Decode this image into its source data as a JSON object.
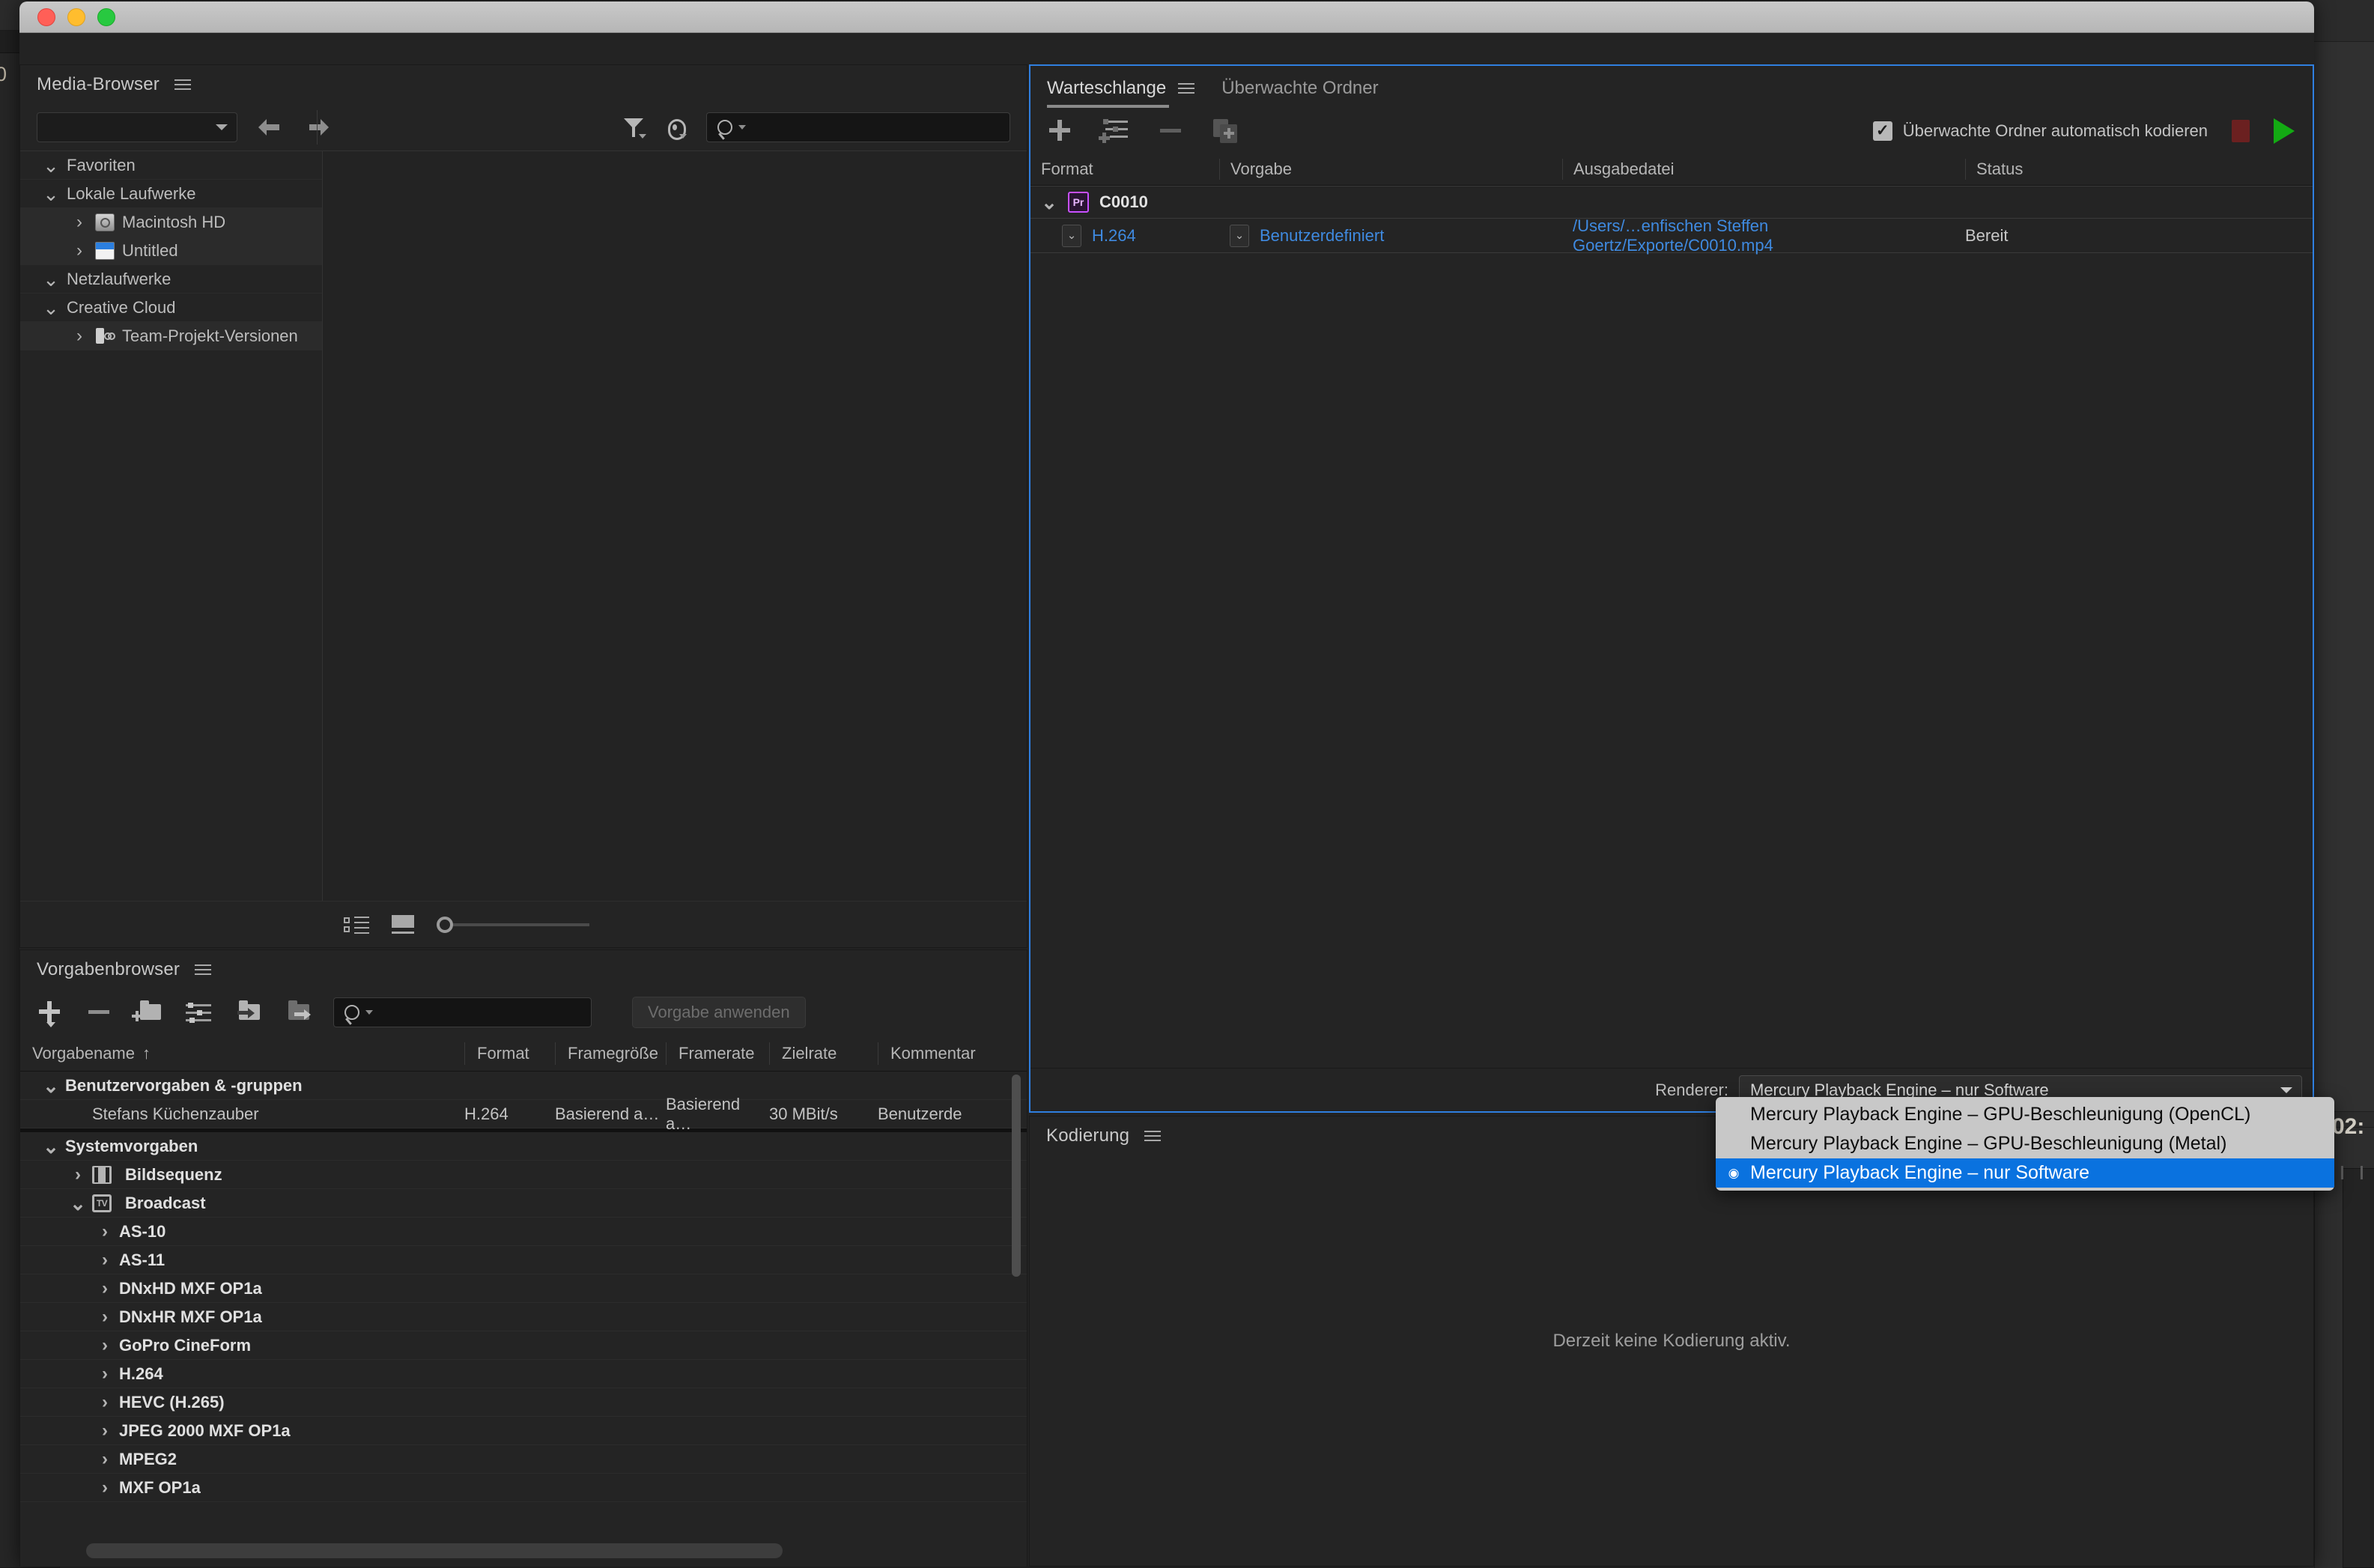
{
  "app": {
    "titlebar_buttons": [
      "close",
      "minimize",
      "maximize"
    ]
  },
  "background": {
    "left_fragment_text": "0",
    "right_fragment_text": "02:"
  },
  "media_browser": {
    "title": "Media-Browser",
    "path_value": "",
    "search_placeholder": "",
    "icons": {
      "menu": "hamburger-icon",
      "back": "back-arrow-icon",
      "forward": "forward-arrow-icon",
      "filter": "funnel-icon",
      "visibility": "eye-icon",
      "search": "search-icon",
      "list_view": "list-view-icon",
      "thumbnail_view": "thumbnail-view-icon",
      "zoom": "zoom-slider-icon"
    },
    "tree": [
      {
        "label": "Favoriten",
        "twisty": "down",
        "indent": 0,
        "icon": null,
        "highlight": false
      },
      {
        "label": "Lokale Laufwerke",
        "twisty": "down",
        "indent": 0,
        "icon": null,
        "highlight": false
      },
      {
        "label": "Macintosh HD",
        "twisty": "right",
        "indent": 1,
        "icon": "harddisk-icon",
        "highlight": true
      },
      {
        "label": "Untitled",
        "twisty": "right",
        "indent": 1,
        "icon": "volume-icon",
        "highlight": true
      },
      {
        "label": "Netzlaufwerke",
        "twisty": "down",
        "indent": 0,
        "icon": null,
        "highlight": false
      },
      {
        "label": "Creative Cloud",
        "twisty": "down",
        "indent": 0,
        "icon": null,
        "highlight": false
      },
      {
        "label": "Team-Projekt-Versionen",
        "twisty": "right",
        "indent": 1,
        "icon": "team-project-icon",
        "highlight": true
      }
    ]
  },
  "preset_browser": {
    "title": "Vorgabenbrowser",
    "search_placeholder": "",
    "apply_button": "Vorgabe anwenden",
    "icons": {
      "menu": "hamburger-icon",
      "new_preset": "new-preset-plus-icon",
      "delete_preset": "delete-preset-minus-icon",
      "new_group": "new-folder-icon",
      "settings": "preset-settings-icon",
      "import_preset": "import-preset-icon",
      "export_preset": "export-preset-icon",
      "search": "search-icon"
    },
    "columns": [
      "Vorgabename",
      "Format",
      "Framegröße",
      "Framerate",
      "Zielrate",
      "Kommentar"
    ],
    "sort_column": "Vorgabename",
    "sort_direction": "↑",
    "rows": [
      {
        "type": "group",
        "label": "Benutzervorgaben & -gruppen",
        "twisty": "down",
        "indent": 0,
        "icon": null,
        "format": "",
        "framesize": "",
        "framerate": "",
        "bitrate": "",
        "comment": ""
      },
      {
        "type": "preset",
        "label": "Stefans Küchenzauber",
        "twisty": "none",
        "indent": 1,
        "icon": null,
        "format": "H.264",
        "framesize": "Basierend a…",
        "framerate": "Basierend a…",
        "bitrate": "30 MBit/s",
        "comment": "Benutzerde"
      },
      {
        "type": "separator"
      },
      {
        "type": "group",
        "label": "Systemvorgaben",
        "twisty": "down",
        "indent": 0,
        "icon": null,
        "format": "",
        "framesize": "",
        "framerate": "",
        "bitrate": "",
        "comment": ""
      },
      {
        "type": "group",
        "label": "Bildsequenz",
        "twisty": "right",
        "indent": 1,
        "icon": "film-icon",
        "format": "",
        "framesize": "",
        "framerate": "",
        "bitrate": "",
        "comment": ""
      },
      {
        "type": "group",
        "label": "Broadcast",
        "twisty": "down",
        "indent": 1,
        "icon": "tv-icon",
        "format": "",
        "framesize": "",
        "framerate": "",
        "bitrate": "",
        "comment": ""
      },
      {
        "type": "group",
        "label": "AS-10",
        "twisty": "right",
        "indent": 2,
        "icon": null,
        "format": "",
        "framesize": "",
        "framerate": "",
        "bitrate": "",
        "comment": ""
      },
      {
        "type": "group",
        "label": "AS-11",
        "twisty": "right",
        "indent": 2,
        "icon": null,
        "format": "",
        "framesize": "",
        "framerate": "",
        "bitrate": "",
        "comment": ""
      },
      {
        "type": "group",
        "label": "DNxHD MXF OP1a",
        "twisty": "right",
        "indent": 2,
        "icon": null,
        "format": "",
        "framesize": "",
        "framerate": "",
        "bitrate": "",
        "comment": ""
      },
      {
        "type": "group",
        "label": "DNxHR MXF OP1a",
        "twisty": "right",
        "indent": 2,
        "icon": null,
        "format": "",
        "framesize": "",
        "framerate": "",
        "bitrate": "",
        "comment": ""
      },
      {
        "type": "group",
        "label": "GoPro CineForm",
        "twisty": "right",
        "indent": 2,
        "icon": null,
        "format": "",
        "framesize": "",
        "framerate": "",
        "bitrate": "",
        "comment": ""
      },
      {
        "type": "group",
        "label": "H.264",
        "twisty": "right",
        "indent": 2,
        "icon": null,
        "format": "",
        "framesize": "",
        "framerate": "",
        "bitrate": "",
        "comment": ""
      },
      {
        "type": "group",
        "label": "HEVC (H.265)",
        "twisty": "right",
        "indent": 2,
        "icon": null,
        "format": "",
        "framesize": "",
        "framerate": "",
        "bitrate": "",
        "comment": ""
      },
      {
        "type": "group",
        "label": "JPEG 2000 MXF OP1a",
        "twisty": "right",
        "indent": 2,
        "icon": null,
        "format": "",
        "framesize": "",
        "framerate": "",
        "bitrate": "",
        "comment": ""
      },
      {
        "type": "group",
        "label": "MPEG2",
        "twisty": "right",
        "indent": 2,
        "icon": null,
        "format": "",
        "framesize": "",
        "framerate": "",
        "bitrate": "",
        "comment": ""
      },
      {
        "type": "group",
        "label": "MXF OP1a",
        "twisty": "right",
        "indent": 2,
        "icon": null,
        "format": "",
        "framesize": "",
        "framerate": "",
        "bitrate": "",
        "comment": ""
      }
    ]
  },
  "queue": {
    "tabs": [
      {
        "label": "Warteschlange",
        "selected": true,
        "has_menu": true
      },
      {
        "label": "Überwachte Ordner",
        "selected": false,
        "has_menu": false
      }
    ],
    "icons": {
      "add": "plus-icon",
      "add_preset": "add-preset-icon",
      "remove": "minus-icon",
      "duplicate": "duplicate-icon",
      "stop": "stop-button-icon",
      "start": "start-queue-icon"
    },
    "auto_encode_checkbox": {
      "label": "Überwachte Ordner automatisch kodieren",
      "checked": true,
      "check_glyph": "✓"
    },
    "columns": [
      "Format",
      "Vorgabe",
      "Ausgabedatei",
      "Status"
    ],
    "groups": [
      {
        "name": "C0010",
        "badge": "Pr",
        "twisty": "down",
        "items": [
          {
            "format": "H.264",
            "preset": "Benutzerdefiniert",
            "output_file": "/Users/…enfischen Steffen Goertz/Exporte/C0010.mp4",
            "status": "Bereit"
          }
        ]
      }
    ],
    "renderer": {
      "label": "Renderer:",
      "value": "Mercury Playback Engine – nur Software"
    }
  },
  "renderer_dropdown": {
    "open": true,
    "options": [
      {
        "label": "Mercury Playback Engine – GPU-Beschleunigung (OpenCL)",
        "selected": false,
        "bullet": ""
      },
      {
        "label": "Mercury Playback Engine – GPU-Beschleunigung (Metal)",
        "selected": false,
        "bullet": ""
      },
      {
        "label": "Mercury Playback Engine – nur Software",
        "selected": true,
        "bullet": "◉"
      }
    ]
  },
  "encoding": {
    "title": "Kodierung",
    "empty_message": "Derzeit keine Kodierung aktiv.",
    "icons": {
      "menu": "hamburger-icon"
    }
  },
  "colors": {
    "accent_blue": "#2f7fe0",
    "link_blue": "#3f8ae0",
    "selection_blue": "#0a72df",
    "start_green": "#13aa13",
    "stop_red": "#6b2020",
    "premiere_purple": "#c850ff",
    "panel_bg": "#242424"
  }
}
